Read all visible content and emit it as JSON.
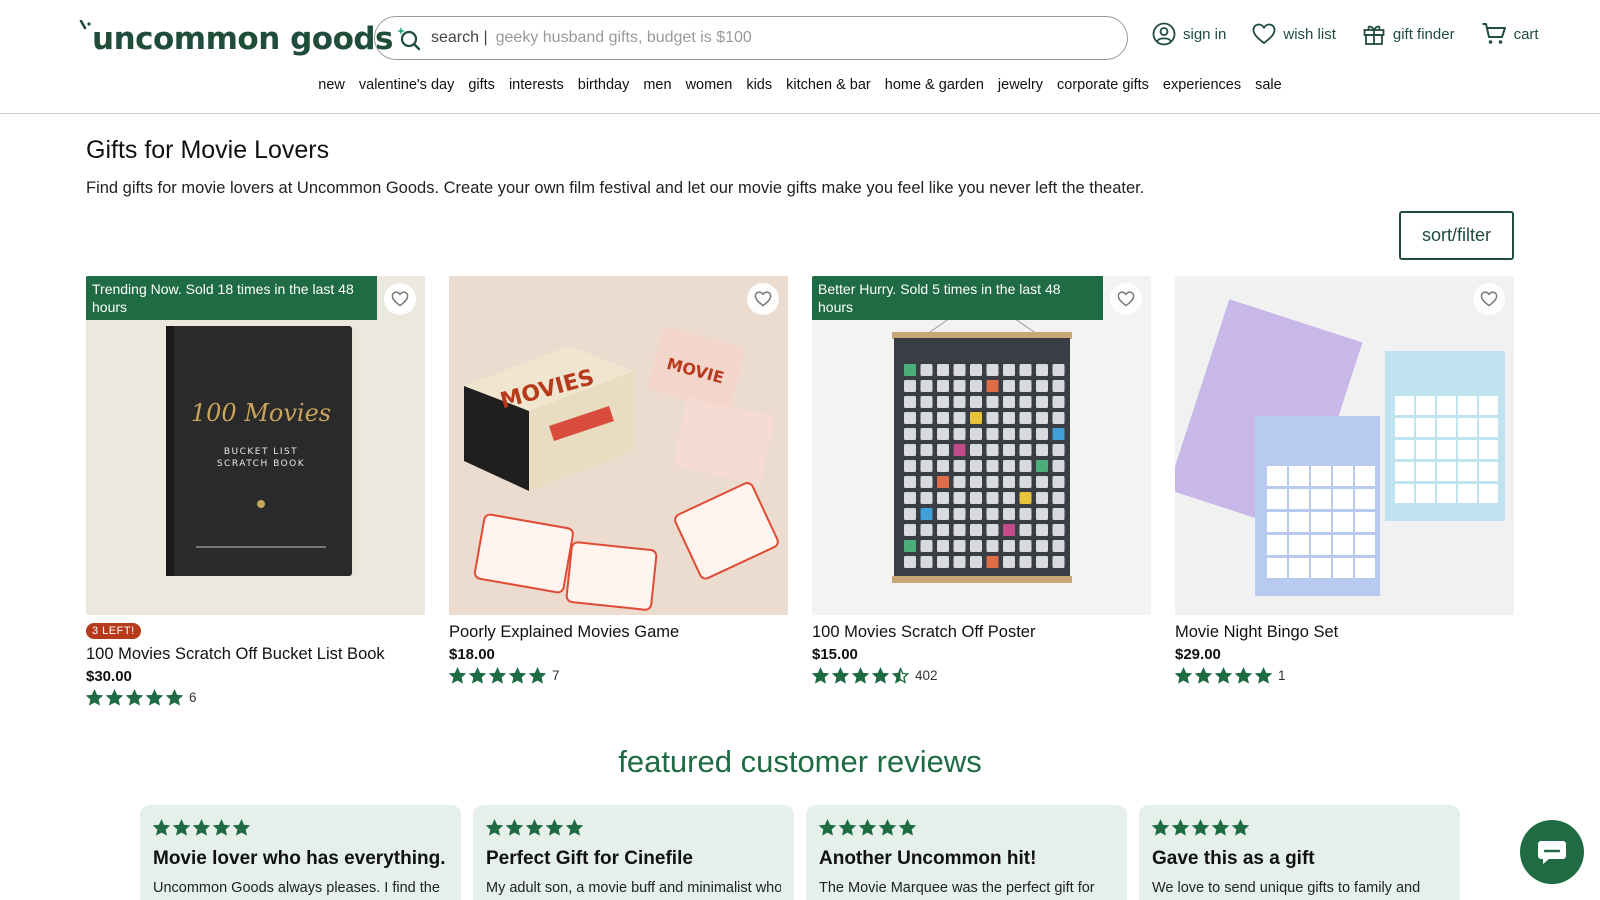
{
  "brand": {
    "name": "uncommon goods",
    "accent": "#1f4d3a",
    "promo_green": "#1f6b43",
    "badge_red": "#b73a1d"
  },
  "search": {
    "label": "search |",
    "placeholder": "geeky husband gifts, budget is $100",
    "value": ""
  },
  "utility": [
    {
      "label": "sign in",
      "icon": "user-circle-icon"
    },
    {
      "label": "wish list",
      "icon": "heart-icon"
    },
    {
      "label": "gift finder",
      "icon": "gift-icon"
    },
    {
      "label": "cart",
      "icon": "cart-icon"
    }
  ],
  "nav": [
    "new",
    "valentine's day",
    "gifts",
    "interests",
    "birthday",
    "men",
    "women",
    "kids",
    "kitchen & bar",
    "home & garden",
    "jewelry",
    "corporate gifts",
    "experiences",
    "sale"
  ],
  "page": {
    "title": "Gifts for Movie Lovers",
    "description": "Find gifts for movie lovers at Uncommon Goods. Create your own film festival and let our movie gifts make you feel like you never left the theater.",
    "sort_label": "sort/filter"
  },
  "products": [
    {
      "promo": "Trending Now. Sold 18 times in the last 48 hours",
      "stock": "3 LEFT!",
      "name": "100 Movies Scratch Off Bucket List Book",
      "price": "$30.00",
      "rating": 5,
      "reviews": "6",
      "image": "black-book-icon"
    },
    {
      "promo": "",
      "stock": "",
      "name": "Poorly Explained Movies Game",
      "price": "$18.00",
      "rating": 5,
      "reviews": "7",
      "image": "card-game-icon"
    },
    {
      "promo": "Better Hurry. Sold 5 times in the last 48 hours",
      "stock": "",
      "name": "100 Movies Scratch Off Poster",
      "price": "$15.00",
      "rating": 4.5,
      "reviews": "402",
      "image": "poster-icon"
    },
    {
      "promo": "",
      "stock": "",
      "name": "Movie Night Bingo Set",
      "price": "$29.00",
      "rating": 5,
      "reviews": "1",
      "image": "bingo-cards-icon"
    }
  ],
  "reviews_section": {
    "title": "featured customer reviews",
    "items": [
      {
        "rating": 5,
        "title": "Movie lover who has everything.",
        "text": "Uncommon Goods always pleases. I find the"
      },
      {
        "rating": 5,
        "title": "Perfect Gift for Cinefile",
        "text": "My adult son, a movie buff and minimalist who"
      },
      {
        "rating": 5,
        "title": "Another Uncommon hit!",
        "text": "The Movie Marquee was the perfect gift for"
      },
      {
        "rating": 5,
        "title": "Gave this as a gift",
        "text": "We love to send unique gifts to family and"
      }
    ]
  },
  "chat": {
    "icon": "chat-icon"
  }
}
